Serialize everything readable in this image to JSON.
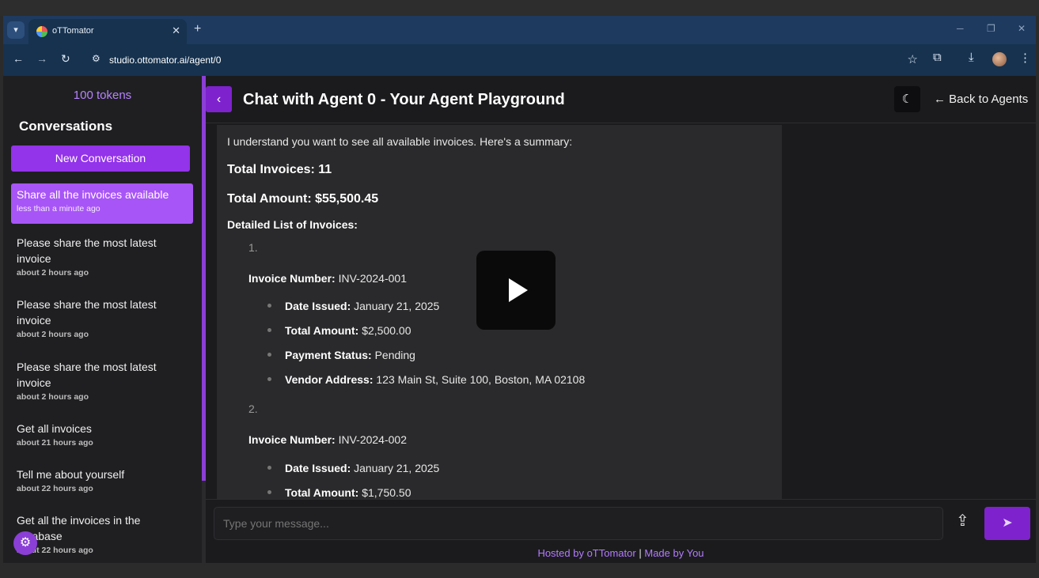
{
  "browser": {
    "tab_title": "oTTomator",
    "tab_close": "✕",
    "new_tab": "+",
    "url": "studio.ottomator.ai/agent/0"
  },
  "sidebar": {
    "tokens": "100 tokens",
    "heading": "Conversations",
    "new_conversation": "New Conversation",
    "items": [
      {
        "title": "Share all the invoices available",
        "time": "less than a minute ago",
        "active": true
      },
      {
        "title": "Please share the most latest invoice",
        "time": "about 2 hours ago"
      },
      {
        "title": "Please share the most latest invoice",
        "time": "about 2 hours ago"
      },
      {
        "title": "Please share the most latest invoice",
        "time": "about 2 hours ago"
      },
      {
        "title": "Get all invoices",
        "time": "about 21 hours ago"
      },
      {
        "title": "Tell me about yourself",
        "time": "about 22 hours ago"
      },
      {
        "title": "Get all the invoices in the database",
        "time": "about 22 hours ago"
      }
    ]
  },
  "header": {
    "title": "Chat with Agent 0 - Your Agent Playground",
    "back_to_agents": "Back to Agents"
  },
  "message": {
    "intro": "I understand you want to see all available invoices. Here's a summary:",
    "total_invoices": "Total Invoices: 11",
    "total_amount": "Total Amount: $55,500.45",
    "list_heading": "Detailed List of Invoices:",
    "invoices": [
      {
        "num": "1.",
        "number_label": "Invoice Number:",
        "number": "INV-2024-001",
        "date_label": "Date Issued:",
        "date": "January 21, 2025",
        "amount_label": "Total Amount:",
        "amount": "$2,500.00",
        "status_label": "Payment Status:",
        "status": "Pending",
        "address_label": "Vendor Address:",
        "address": "123 Main St, Suite 100, Boston, MA 02108"
      },
      {
        "num": "2.",
        "number_label": "Invoice Number:",
        "number": "INV-2024-002",
        "date_label": "Date Issued:",
        "date": "January 21, 2025",
        "amount_label": "Total Amount:",
        "amount": "$1,750.50"
      }
    ]
  },
  "input": {
    "placeholder": "Type your message..."
  },
  "footer": {
    "hosted": "Hosted by oTTomator",
    "separator": "|",
    "made": "Made by You"
  },
  "icons": {
    "tab_list": "chevron-down-icon",
    "favicon": "ottomator-favicon",
    "back": "arrow-left-icon",
    "forward": "arrow-right-icon",
    "reload": "reload-icon",
    "site_info": "site-settings-icon",
    "bookmark": "star-icon",
    "extensions": "puzzle-icon",
    "downloads": "download-icon",
    "profile": "avatar",
    "menu": "kebab-menu-icon",
    "collapse_sidebar": "chevron-left-icon",
    "theme": "moon-icon",
    "upload": "upload-icon",
    "send": "send-icon",
    "settings": "gear-icon",
    "video": "play-icon"
  },
  "colors": {
    "accent": "#9333ea",
    "active_item": "#a855f7",
    "tokens": "#b783ff",
    "browser_chrome": "#1e3a5f"
  }
}
